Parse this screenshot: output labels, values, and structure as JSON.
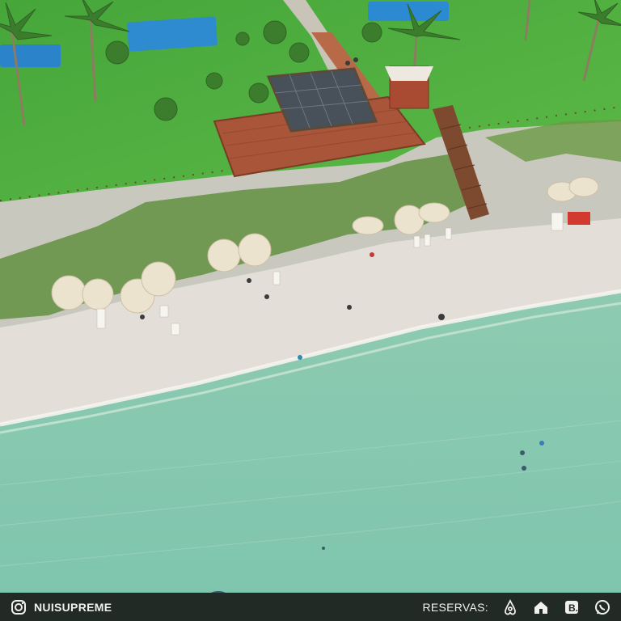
{
  "footer": {
    "brand_handle": "NUISUPREME",
    "reservations_label": "RESERVAS:",
    "icons": [
      "instagram-icon",
      "airbnb-icon",
      "house-booking-icon",
      "booking-b-icon",
      "whatsapp-icon"
    ]
  },
  "colors": {
    "sea": "#88c7ad",
    "sand": "#e2ded7",
    "lawn": "#4cae3e",
    "deck": "#a14f34",
    "pool": "#2b83c9",
    "footer_bg": "#222a25"
  }
}
